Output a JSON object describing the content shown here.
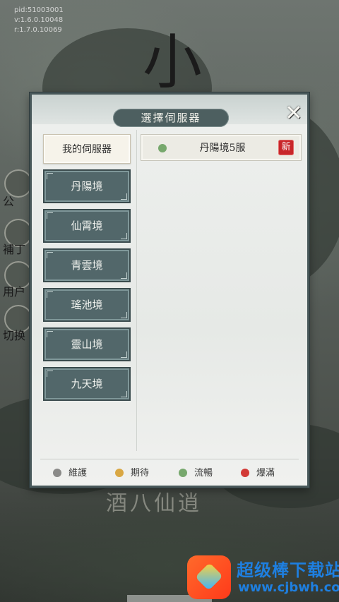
{
  "version_lines": [
    "pid:51003001",
    "v:1.6.0.10048",
    "r:1.7.0.10069"
  ],
  "background": {
    "logo_glyph": "小",
    "side_labels": [
      "公",
      "補丁",
      "用户",
      "切换"
    ],
    "bottom_text": "酒八仙逍"
  },
  "dialog": {
    "title": "選擇伺服器",
    "close_icon": "✕",
    "my_server_label": "我的伺服器",
    "regions": [
      {
        "label": "丹陽境"
      },
      {
        "label": "仙霄境"
      },
      {
        "label": "青雲境"
      },
      {
        "label": "瑤池境"
      },
      {
        "label": "靈山境"
      },
      {
        "label": "九天境"
      }
    ],
    "servers": [
      {
        "name": "丹陽境5服",
        "status": "流暢",
        "status_color": "#77a86d",
        "badge": "新"
      }
    ],
    "legend": [
      {
        "label": "維護",
        "color": "#8a8a88"
      },
      {
        "label": "期待",
        "color": "#d9a743"
      },
      {
        "label": "流暢",
        "color": "#77a86d"
      },
      {
        "label": "爆滿",
        "color": "#d23a36"
      }
    ]
  },
  "watermark": {
    "title": "超级棒下载站",
    "url": "www.cjbwh.com"
  }
}
